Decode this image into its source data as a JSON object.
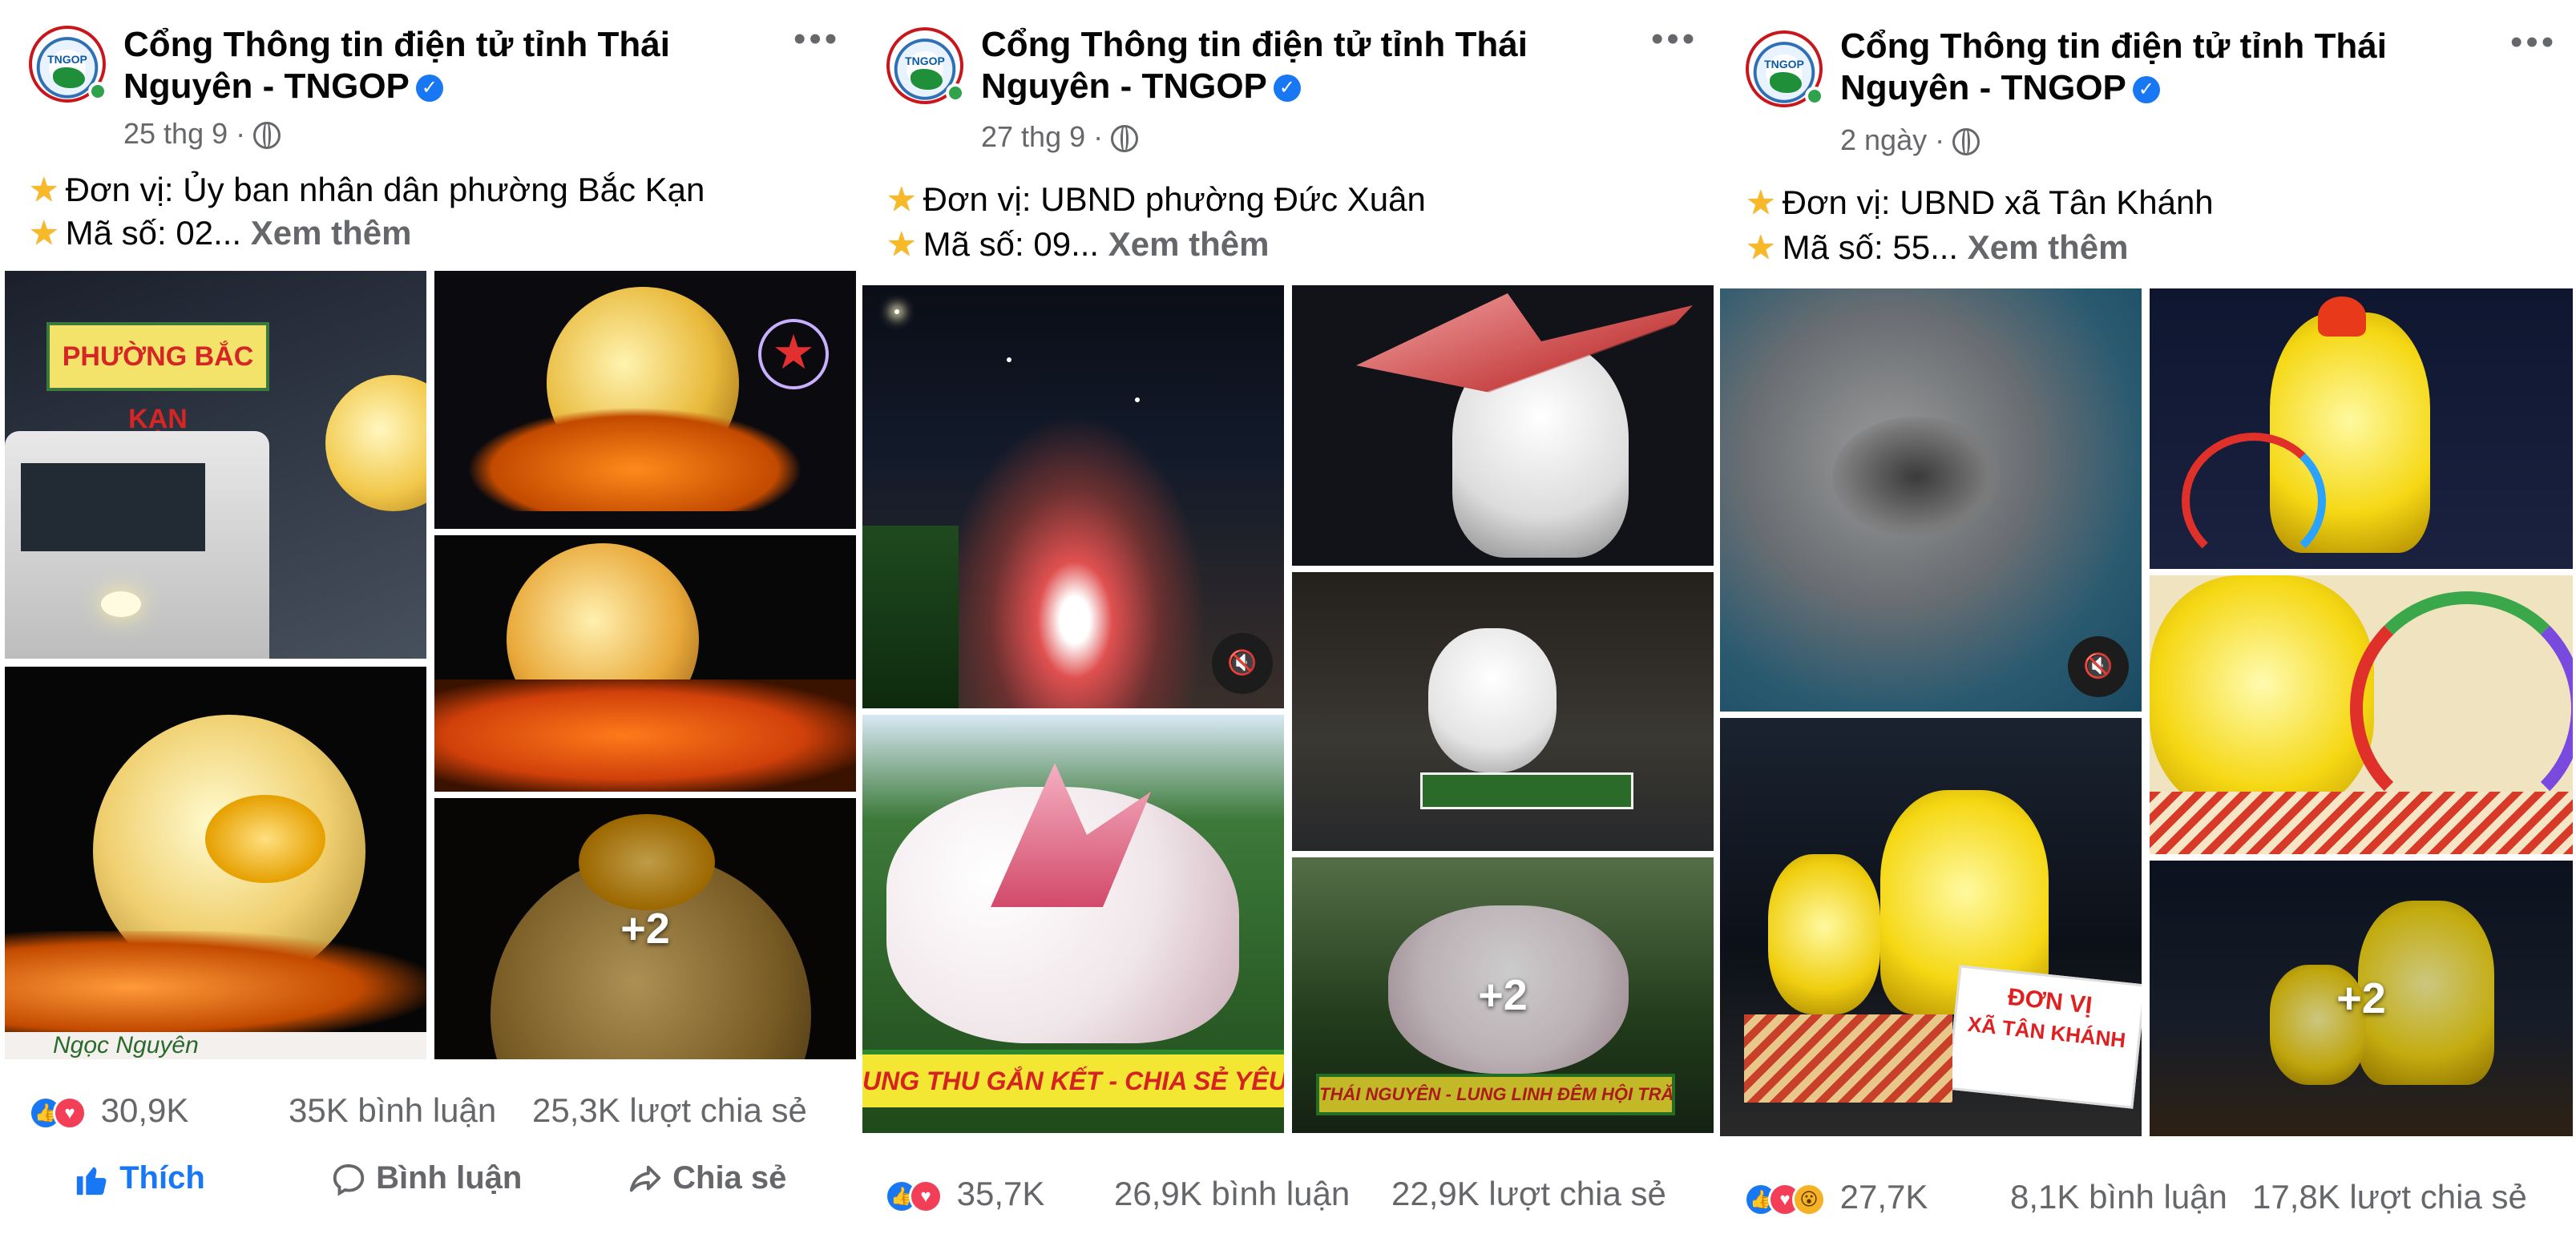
{
  "posts": [
    {
      "page_name_line1": "Cổng Thông tin điện tử tỉnh Thái",
      "page_name_line2": "Nguyên - TNGOP",
      "date": "25 thg 9 ·",
      "line1_prefix": "Đơn vị: ",
      "line1_value": "Ủy ban nhân dân phường Bắc Kạn",
      "line2_prefix": "Mã số: 02...",
      "see_more": "Xem thêm",
      "photo_captions": [
        "PHƯỜNG BẮC KẠN"
      ],
      "banner_text": "Ngọc Nguyên",
      "more_photos": "+2",
      "reactions_count": "30,9K",
      "comments": "35K bình luận",
      "shares": "25,3K lượt chia sẻ",
      "actions": {
        "like": "Thích",
        "comment": "Bình luận",
        "share": "Chia sẻ"
      }
    },
    {
      "page_name_line1": "Cổng Thông tin điện tử tỉnh Thái",
      "page_name_line2": "Nguyên - TNGOP",
      "date": "27 thg 9 ·",
      "line1_prefix": "Đơn vị: ",
      "line1_value": "UBND phường Đức Xuân",
      "line2_prefix": "Mã số: 09...",
      "see_more": "Xem thêm",
      "banner_text": "UNG THU GẮN KẾT - CHIA SẺ YÊU THƯƠNG",
      "banner_text_2": "THÁI NGUYÊN - LUNG LINH ĐÊM HỘI TRĂNG RẰM",
      "more_photos": "+2",
      "reactions_count": "35,7K",
      "comments": "26,9K bình luận",
      "shares": "22,9K lượt chia sẻ"
    },
    {
      "page_name_line1": "Cổng Thông tin điện tử tỉnh Thái",
      "page_name_line2": "Nguyên - TNGOP",
      "date": "2 ngày ·",
      "line1_prefix": "Đơn vị: ",
      "line1_value": "UBND xã Tân Khánh",
      "line2_prefix": "Mã số: 55...",
      "see_more": "Xem thêm",
      "sign_line1": "ĐƠN VỊ",
      "sign_line2": "XÃ TÂN KHÁNH",
      "more_photos": "+2",
      "reactions_count": "27,7K",
      "comments": "8,1K bình luận",
      "shares": "17,8K lượt chia sẻ"
    }
  ],
  "avatar_text": "TNGOP",
  "icons": [
    "verified-icon",
    "globe-icon",
    "more-icon",
    "star-icon",
    "mute-icon",
    "like-reaction-icon",
    "love-reaction-icon",
    "wow-reaction-icon",
    "thumbs-up-icon",
    "comment-icon",
    "share-icon"
  ],
  "colors": {
    "brand_blue": "#1877f2",
    "secondary_text": "#65676b",
    "love": "#f33e58",
    "online": "#31a24c"
  }
}
